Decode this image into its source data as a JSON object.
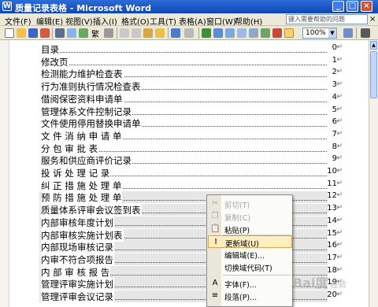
{
  "window": {
    "title": "质量记录表格 - Microsoft Word",
    "app_icon": "word-icon",
    "controls": [
      "minimize-icon",
      "maximize-icon",
      "close-icon"
    ]
  },
  "menu": {
    "items": [
      "文件(F)",
      "编辑(E)",
      "视图(V)",
      "插入(I)",
      "格式(O)",
      "工具(T)",
      "表格(A)",
      "窗口(W)",
      "帮助(H)"
    ],
    "help_placeholder": "键入需要帮助的问题",
    "close_glyph": "×"
  },
  "toolbar": {
    "font_label": "繁",
    "zoom": "100%",
    "zoom_arrow": "▼"
  },
  "toc": [
    {
      "text": "目录",
      "page": "0"
    },
    {
      "text": "修改页",
      "page": "1"
    },
    {
      "text": "检测能力维护检查表",
      "page": "2"
    },
    {
      "text": "行为准则执行情况检查表",
      "page": "3"
    },
    {
      "text": "借阅保密资料申请单",
      "page": "4"
    },
    {
      "text": "管理体系文件控制记录",
      "page": "5"
    },
    {
      "text": "文件使用停用替换申请单",
      "page": "6"
    },
    {
      "text": "文 件 消 纳 申 请 单",
      "page": "7"
    },
    {
      "text": "分  包  审  批  表",
      "page": "8"
    },
    {
      "text": "服务和供应商评价记录",
      "page": "9"
    },
    {
      "text": "投  诉  处  理  记  录",
      "page": "10"
    },
    {
      "text": "纠 正 措 施 处 理 单",
      "page": "11"
    },
    {
      "text": "预 防 措 施 处 理 单",
      "page": "12"
    },
    {
      "text": "质量体系评审会议签到表",
      "page": "13"
    },
    {
      "text": "内部审核年度计划",
      "page": "14"
    },
    {
      "text": "内部审核实施计划表",
      "page": "15"
    },
    {
      "text": "内部现场审核记录",
      "page": "16"
    },
    {
      "text": "内审不符合项报告",
      "page": "17"
    },
    {
      "text": "内 部 审 核 报 告",
      "page": "18"
    },
    {
      "text": "管理评审实施计划",
      "page": "19"
    },
    {
      "text": "管理评审会议记录",
      "page": "20"
    }
  ],
  "paragraph_mark": "↵",
  "context_menu": {
    "items": [
      {
        "label": "剪切(T)",
        "icon": "cut-icon",
        "glyph": "✂",
        "enabled": false
      },
      {
        "label": "复制(C)",
        "icon": "copy-icon",
        "glyph": "❐",
        "enabled": false
      },
      {
        "label": "粘贴(P)",
        "icon": "paste-icon",
        "glyph": "📋",
        "enabled": true
      },
      {
        "label": "更新域(U)",
        "icon": "update-field-icon",
        "glyph": "!",
        "enabled": true,
        "highlighted": true
      },
      {
        "label": "编辑域(E)...",
        "icon": "",
        "glyph": "",
        "enabled": true
      },
      {
        "label": "切换域代码(T)",
        "icon": "",
        "glyph": "",
        "enabled": true
      },
      {
        "label": "字体(F)...",
        "icon": "font-icon",
        "glyph": "A",
        "enabled": true
      },
      {
        "label": "段落(P)...",
        "icon": "paragraph-icon",
        "glyph": "≡",
        "enabled": true
      },
      {
        "label": "项目符号和编号(N)...",
        "icon": "bullets-icon",
        "glyph": "☰",
        "enabled": true
      },
      {
        "label": "符号(S)",
        "icon": "",
        "glyph": "",
        "enabled": true
      }
    ]
  },
  "watermark": {
    "text": "Bai度",
    "sub": "经验"
  }
}
